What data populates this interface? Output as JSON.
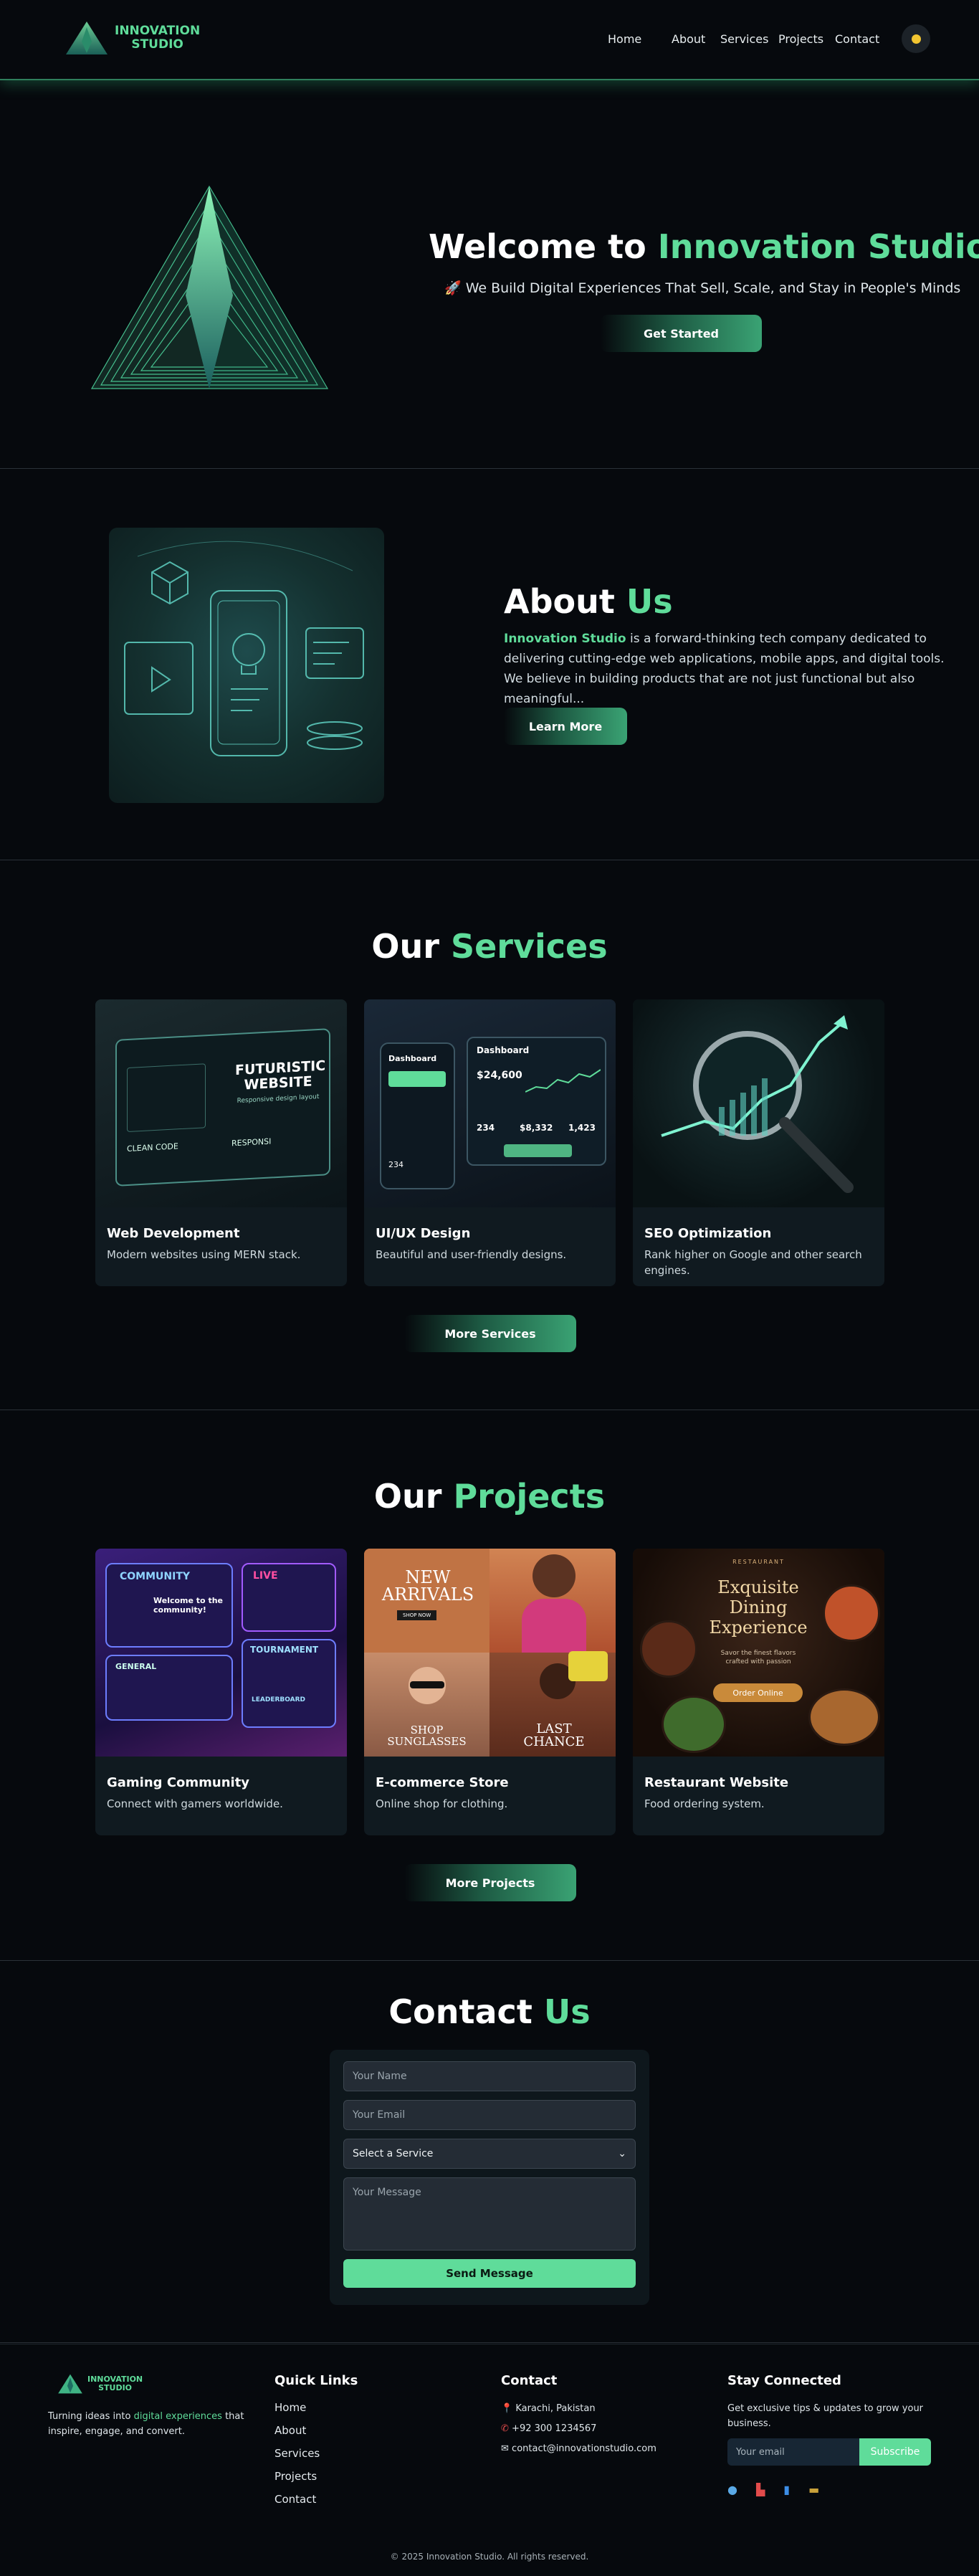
{
  "nav": {
    "logo_line1": "INNOVATION",
    "logo_line2": "STUDIO",
    "links": [
      "Home",
      "About",
      "Services",
      "Projects",
      "Contact"
    ],
    "theme_icon": "sun-dot-icon"
  },
  "hero": {
    "title_prefix": "Welcome to ",
    "title_accent": "Innovation Studio",
    "subtitle": "🚀 We Build Digital Experiences That Sell, Scale, and Stay in People's Minds",
    "cta": "Get Started"
  },
  "about": {
    "title_prefix": "About ",
    "title_accent": "Us",
    "text_accent": "Innovation Studio",
    "text": " is a forward-thinking tech company dedicated to delivering cutting-edge web applications, mobile apps, and digital tools. We believe in building products that are not just functional but also meaningful...",
    "cta": "Learn More"
  },
  "services": {
    "title_prefix": "Our ",
    "title_accent": "Services",
    "cards": [
      {
        "title": "Web Development",
        "desc": "Modern websites using MERN stack.",
        "img_text1": "FUTURISTIC",
        "img_text2": "WEBSITE",
        "img_text3": "Responsive design layout",
        "img_text4": "CLEAN CODE",
        "img_text5": "RESPONSI"
      },
      {
        "title": "UI/UX Design",
        "desc": "Beautiful and user-friendly designs.",
        "img_text1": "Dashboard",
        "img_text2": "$24,600",
        "img_text3": "234",
        "img_text4": "$8,332",
        "img_text5": "1,423"
      },
      {
        "title": "SEO Optimization",
        "desc": "Rank higher on Google and other search engines."
      }
    ],
    "more": "More Services"
  },
  "projects": {
    "title_prefix": "Our ",
    "title_accent": "Projects",
    "cards": [
      {
        "title": "Gaming Community",
        "desc": "Connect with gamers worldwide.",
        "img_text1": "COMMUNITY",
        "img_text2": "Welcome to the community!",
        "img_text3": "LIVE",
        "img_text4": "GENERAL",
        "img_text5": "TOURNAMENT",
        "img_text6": "LEADERBOARD"
      },
      {
        "title": "E-commerce Store",
        "desc": "Online shop for clothing.",
        "img_text1": "NEW ARRIVALS",
        "img_text2": "SHOP NOW",
        "img_text3": "SHOP SUNGLASSES",
        "img_text4": "LAST CHANCE"
      },
      {
        "title": "Restaurant Website",
        "desc": "Food ordering system.",
        "img_text1": "RESTAURANT",
        "img_text2": "Exquisite Dining Experience",
        "img_text3": "Savor the finest flavors crafted with passion",
        "img_text4": "Order Online"
      }
    ],
    "more": "More Projects"
  },
  "contact": {
    "title_prefix": "Contact ",
    "title_accent": "Us",
    "name_placeholder": "Your Name",
    "email_placeholder": "Your Email",
    "service_selected": "Select a Service",
    "message_placeholder": "Your Message",
    "send": "Send Message"
  },
  "footer": {
    "logo_line1": "INNOVATION",
    "logo_line2": "STUDIO",
    "tagline_a": "Turning ideas into ",
    "tagline_accent": "digital experiences",
    "tagline_b": " that inspire, engage, and convert.",
    "quick_links_title": "Quick Links",
    "quick_links": [
      "Home",
      "About",
      "Services",
      "Projects",
      "Contact"
    ],
    "contact_title": "Contact",
    "location": "Karachi, Pakistan",
    "phone": "+92 300 1234567",
    "email": "contact@innovationstudio.com",
    "stay_title": "Stay Connected",
    "stay_text": "Get exclusive tips & updates to grow your business.",
    "email_placeholder": "Your email",
    "subscribe": "Subscribe",
    "social_icons": [
      "globe-icon",
      "boot-icon",
      "book-icon",
      "briefcase-icon"
    ],
    "copyright": "© 2025 Innovation Studio. All rights reserved."
  }
}
